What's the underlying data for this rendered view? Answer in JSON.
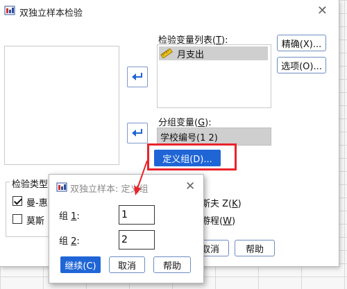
{
  "main_dialog": {
    "title": "双独立样本检验",
    "test_list_label": "检验变量列表(",
    "test_list_key": "T",
    "test_list_suffix": "):",
    "test_variables": [
      {
        "icon": "ruler-icon",
        "label": "月支出"
      }
    ],
    "grouping_label": "分组变量(",
    "grouping_key": "G",
    "grouping_suffix": "):",
    "grouping_variable": "学校编号(1 2)",
    "define_groups_button": "定义组(D)...",
    "exact_button": "精确(X)...",
    "options_button": "选项(O)...",
    "test_type_title": "检验类型",
    "checkbox_mann_whitney": "曼-惠",
    "checkbox_moses": "莫斯",
    "kolmogorov_partial": "斯夫 Z(",
    "kolmogorov_key": "K",
    "kolmogorov_suffix": ")",
    "wald_partial": "游程(",
    "wald_key": "W",
    "wald_suffix": ")",
    "cancel_button": "取消",
    "help_button": "帮助"
  },
  "sub_dialog": {
    "title": "双独立样本: 定义组",
    "group1_label": "组 ",
    "group1_key": "1",
    "group1_suffix": ":",
    "group1_value": "1",
    "group2_label": "组 ",
    "group2_key": "2",
    "group2_suffix": ":",
    "group2_value": "2",
    "continue_button": "继续(C)",
    "cancel_button": "取消",
    "help_button": "帮助"
  },
  "states": {
    "mann_whitney_checked": true,
    "moses_checked": false
  },
  "colors": {
    "accent": "#1f65d6",
    "highlight": "#e8232b"
  }
}
